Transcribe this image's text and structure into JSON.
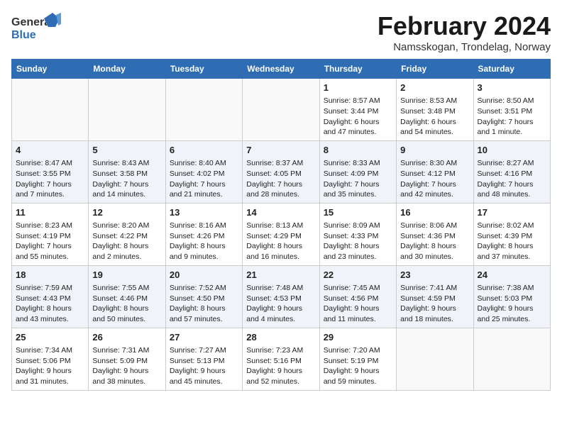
{
  "header": {
    "logo_line1": "General",
    "logo_line2": "Blue",
    "month_title": "February 2024",
    "location": "Namsskogan, Trondelag, Norway"
  },
  "weekdays": [
    "Sunday",
    "Monday",
    "Tuesday",
    "Wednesday",
    "Thursday",
    "Friday",
    "Saturday"
  ],
  "weeks": [
    [
      {
        "day": "",
        "info": ""
      },
      {
        "day": "",
        "info": ""
      },
      {
        "day": "",
        "info": ""
      },
      {
        "day": "",
        "info": ""
      },
      {
        "day": "1",
        "info": "Sunrise: 8:57 AM\nSunset: 3:44 PM\nDaylight: 6 hours\nand 47 minutes."
      },
      {
        "day": "2",
        "info": "Sunrise: 8:53 AM\nSunset: 3:48 PM\nDaylight: 6 hours\nand 54 minutes."
      },
      {
        "day": "3",
        "info": "Sunrise: 8:50 AM\nSunset: 3:51 PM\nDaylight: 7 hours\nand 1 minute."
      }
    ],
    [
      {
        "day": "4",
        "info": "Sunrise: 8:47 AM\nSunset: 3:55 PM\nDaylight: 7 hours\nand 7 minutes."
      },
      {
        "day": "5",
        "info": "Sunrise: 8:43 AM\nSunset: 3:58 PM\nDaylight: 7 hours\nand 14 minutes."
      },
      {
        "day": "6",
        "info": "Sunrise: 8:40 AM\nSunset: 4:02 PM\nDaylight: 7 hours\nand 21 minutes."
      },
      {
        "day": "7",
        "info": "Sunrise: 8:37 AM\nSunset: 4:05 PM\nDaylight: 7 hours\nand 28 minutes."
      },
      {
        "day": "8",
        "info": "Sunrise: 8:33 AM\nSunset: 4:09 PM\nDaylight: 7 hours\nand 35 minutes."
      },
      {
        "day": "9",
        "info": "Sunrise: 8:30 AM\nSunset: 4:12 PM\nDaylight: 7 hours\nand 42 minutes."
      },
      {
        "day": "10",
        "info": "Sunrise: 8:27 AM\nSunset: 4:16 PM\nDaylight: 7 hours\nand 48 minutes."
      }
    ],
    [
      {
        "day": "11",
        "info": "Sunrise: 8:23 AM\nSunset: 4:19 PM\nDaylight: 7 hours\nand 55 minutes."
      },
      {
        "day": "12",
        "info": "Sunrise: 8:20 AM\nSunset: 4:22 PM\nDaylight: 8 hours\nand 2 minutes."
      },
      {
        "day": "13",
        "info": "Sunrise: 8:16 AM\nSunset: 4:26 PM\nDaylight: 8 hours\nand 9 minutes."
      },
      {
        "day": "14",
        "info": "Sunrise: 8:13 AM\nSunset: 4:29 PM\nDaylight: 8 hours\nand 16 minutes."
      },
      {
        "day": "15",
        "info": "Sunrise: 8:09 AM\nSunset: 4:33 PM\nDaylight: 8 hours\nand 23 minutes."
      },
      {
        "day": "16",
        "info": "Sunrise: 8:06 AM\nSunset: 4:36 PM\nDaylight: 8 hours\nand 30 minutes."
      },
      {
        "day": "17",
        "info": "Sunrise: 8:02 AM\nSunset: 4:39 PM\nDaylight: 8 hours\nand 37 minutes."
      }
    ],
    [
      {
        "day": "18",
        "info": "Sunrise: 7:59 AM\nSunset: 4:43 PM\nDaylight: 8 hours\nand 43 minutes."
      },
      {
        "day": "19",
        "info": "Sunrise: 7:55 AM\nSunset: 4:46 PM\nDaylight: 8 hours\nand 50 minutes."
      },
      {
        "day": "20",
        "info": "Sunrise: 7:52 AM\nSunset: 4:50 PM\nDaylight: 8 hours\nand 57 minutes."
      },
      {
        "day": "21",
        "info": "Sunrise: 7:48 AM\nSunset: 4:53 PM\nDaylight: 9 hours\nand 4 minutes."
      },
      {
        "day": "22",
        "info": "Sunrise: 7:45 AM\nSunset: 4:56 PM\nDaylight: 9 hours\nand 11 minutes."
      },
      {
        "day": "23",
        "info": "Sunrise: 7:41 AM\nSunset: 4:59 PM\nDaylight: 9 hours\nand 18 minutes."
      },
      {
        "day": "24",
        "info": "Sunrise: 7:38 AM\nSunset: 5:03 PM\nDaylight: 9 hours\nand 25 minutes."
      }
    ],
    [
      {
        "day": "25",
        "info": "Sunrise: 7:34 AM\nSunset: 5:06 PM\nDaylight: 9 hours\nand 31 minutes."
      },
      {
        "day": "26",
        "info": "Sunrise: 7:31 AM\nSunset: 5:09 PM\nDaylight: 9 hours\nand 38 minutes."
      },
      {
        "day": "27",
        "info": "Sunrise: 7:27 AM\nSunset: 5:13 PM\nDaylight: 9 hours\nand 45 minutes."
      },
      {
        "day": "28",
        "info": "Sunrise: 7:23 AM\nSunset: 5:16 PM\nDaylight: 9 hours\nand 52 minutes."
      },
      {
        "day": "29",
        "info": "Sunrise: 7:20 AM\nSunset: 5:19 PM\nDaylight: 9 hours\nand 59 minutes."
      },
      {
        "day": "",
        "info": ""
      },
      {
        "day": "",
        "info": ""
      }
    ]
  ]
}
